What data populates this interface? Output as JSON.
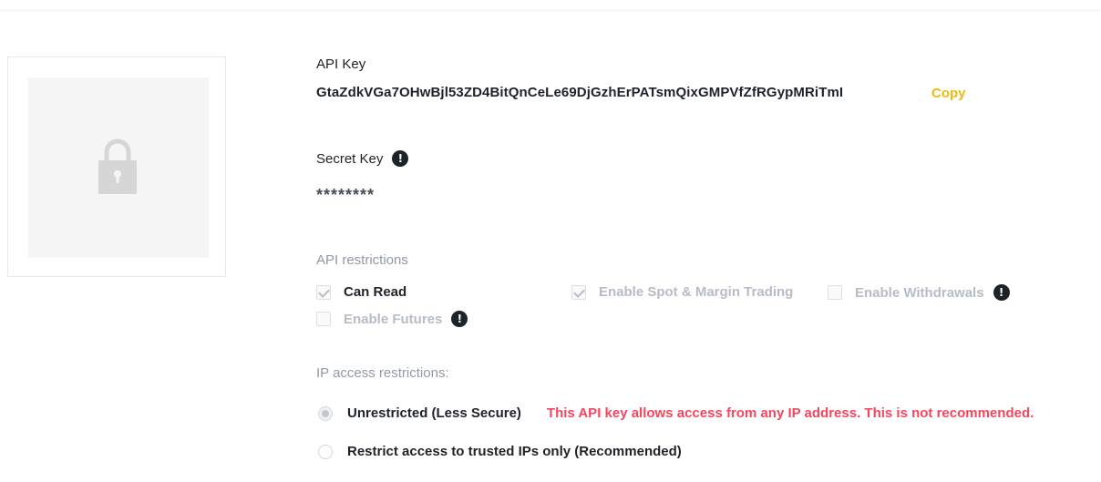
{
  "qr_panel": {
    "icon": "lock-icon"
  },
  "api_key": {
    "label": "API Key",
    "value": "GtaZdkVGa7OHwBjl53ZD4BitQnCeLe69DjGzhErPATsmQixGMPVfZfRGypMRiTmI",
    "copy_label": "Copy"
  },
  "secret_key": {
    "label": "Secret Key",
    "info_icon": "exclamation-icon",
    "value": "********"
  },
  "api_restrictions": {
    "label": "API restrictions",
    "options": [
      {
        "label": "Can Read",
        "checked": true
      },
      {
        "label": "Enable Spot & Margin Trading",
        "checked": true
      },
      {
        "label": "Enable Withdrawals",
        "checked": false
      },
      {
        "label": "Enable Futures",
        "checked": false
      }
    ]
  },
  "ip_restrictions": {
    "label": "IP access restrictions:",
    "options": [
      {
        "label": "Unrestricted (Less Secure)",
        "selected": true
      },
      {
        "label": "Restrict access to trusted IPs only (Recommended)",
        "selected": false
      }
    ],
    "warning": "This API key allows access from any IP address. This is not recommended."
  },
  "colors": {
    "accent": "#f0b90b",
    "danger": "#f6465d",
    "text": "#1e2329",
    "muted": "#929aa5"
  }
}
